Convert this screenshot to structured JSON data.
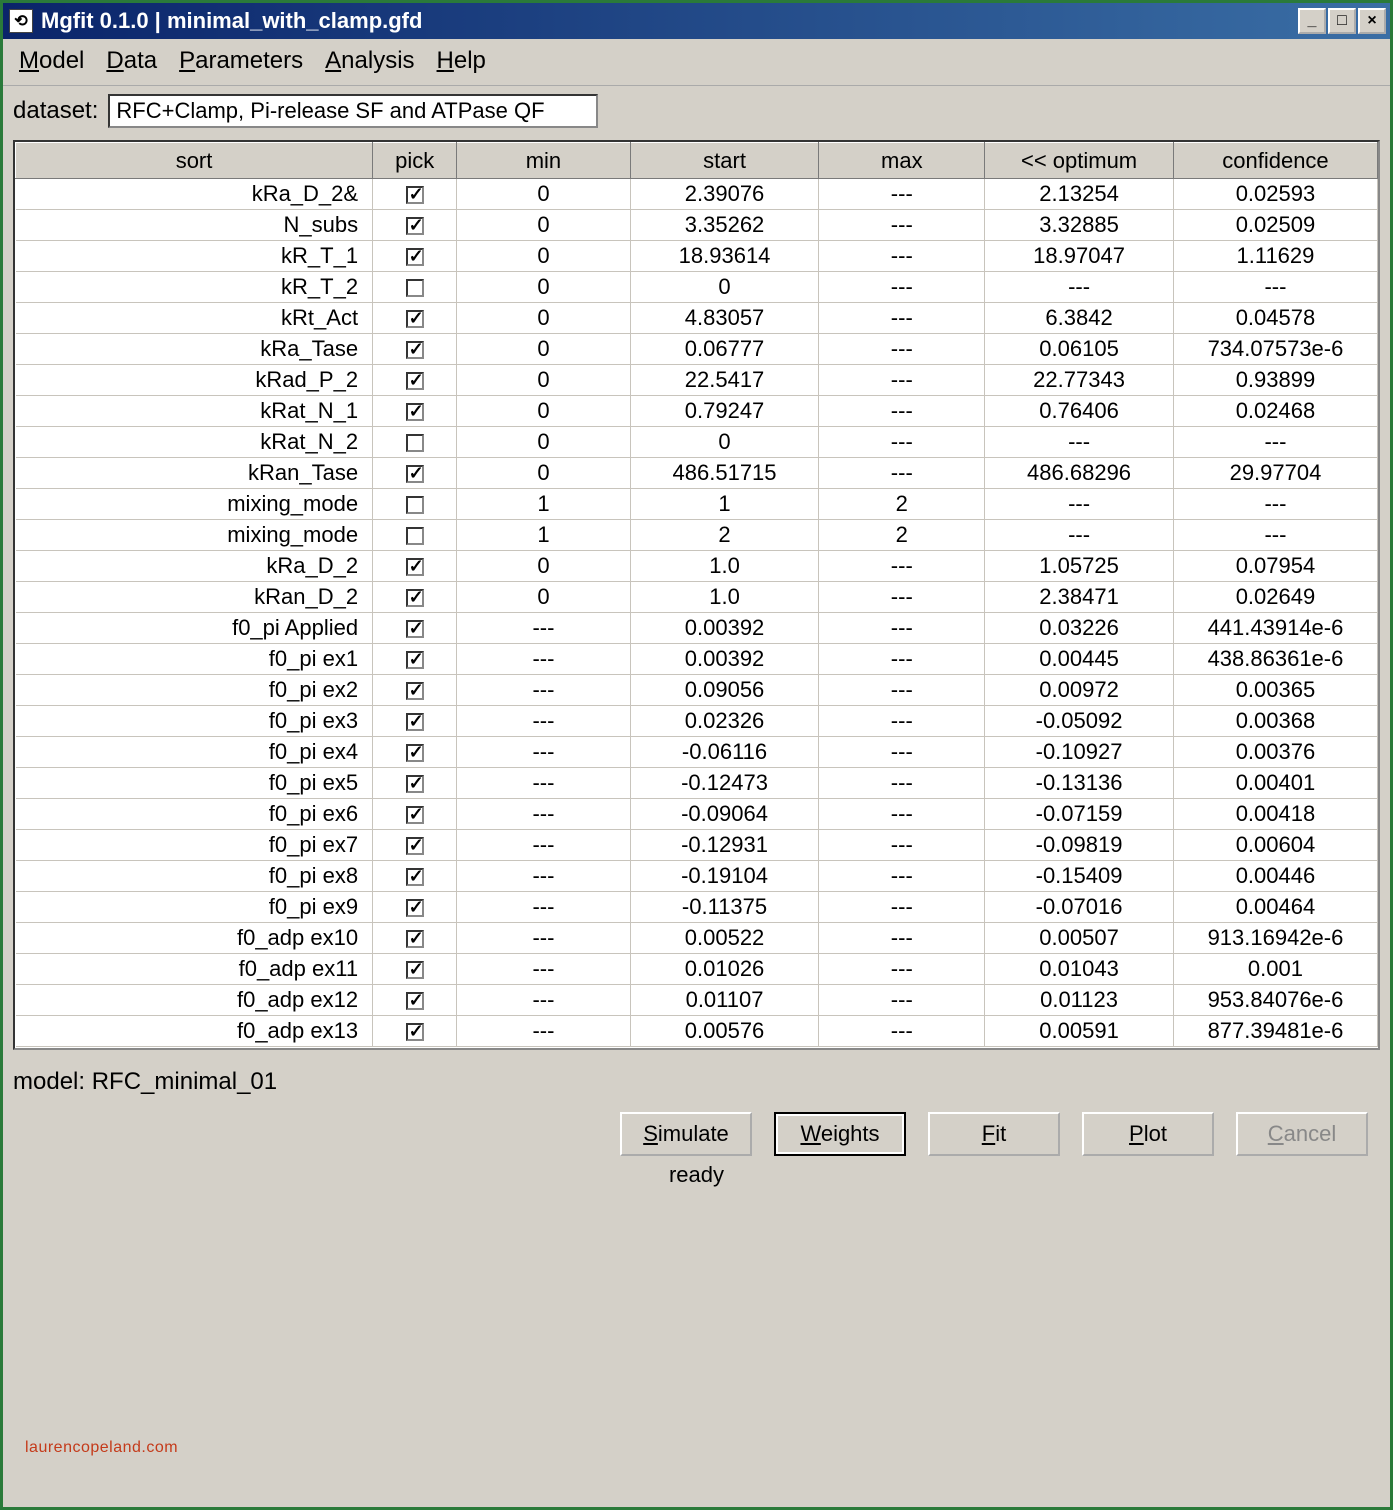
{
  "window": {
    "title": "Mgfit 0.1.0 | minimal_with_clamp.gfd",
    "app_icon_glyph": "⟲"
  },
  "menu": {
    "model": "Model",
    "data": "Data",
    "parameters": "Parameters",
    "analysis": "Analysis",
    "help": "Help"
  },
  "dataset": {
    "label": "dataset:",
    "value": "RFC+Clamp, Pi-release SF and ATPase QF"
  },
  "columns": {
    "sort": "sort",
    "pick": "pick",
    "min": "min",
    "start": "start",
    "max": "max",
    "optimum": "<< optimum",
    "confidence": "confidence"
  },
  "rows": [
    {
      "sort": "kRa_D_2&",
      "pick": true,
      "min": "0",
      "start": "2.39076",
      "max": "---",
      "opt": "2.13254",
      "conf": "0.02593"
    },
    {
      "sort": "N_subs",
      "pick": true,
      "min": "0",
      "start": "3.35262",
      "max": "---",
      "opt": "3.32885",
      "conf": "0.02509"
    },
    {
      "sort": "kR_T_1",
      "pick": true,
      "min": "0",
      "start": "18.93614",
      "max": "---",
      "opt": "18.97047",
      "conf": "1.11629"
    },
    {
      "sort": "kR_T_2",
      "pick": false,
      "min": "0",
      "start": "0",
      "max": "---",
      "opt": "---",
      "conf": "---"
    },
    {
      "sort": "kRt_Act",
      "pick": true,
      "min": "0",
      "start": "4.83057",
      "max": "---",
      "opt": "6.3842",
      "conf": "0.04578"
    },
    {
      "sort": "kRa_Tase",
      "pick": true,
      "min": "0",
      "start": "0.06777",
      "max": "---",
      "opt": "0.06105",
      "conf": "734.07573e-6"
    },
    {
      "sort": "kRad_P_2",
      "pick": true,
      "min": "0",
      "start": "22.5417",
      "max": "---",
      "opt": "22.77343",
      "conf": "0.93899"
    },
    {
      "sort": "kRat_N_1",
      "pick": true,
      "min": "0",
      "start": "0.79247",
      "max": "---",
      "opt": "0.76406",
      "conf": "0.02468"
    },
    {
      "sort": "kRat_N_2",
      "pick": false,
      "min": "0",
      "start": "0",
      "max": "---",
      "opt": "---",
      "conf": "---"
    },
    {
      "sort": "kRan_Tase",
      "pick": true,
      "min": "0",
      "start": "486.51715",
      "max": "---",
      "opt": "486.68296",
      "conf": "29.97704"
    },
    {
      "sort": "mixing_mode",
      "pick": false,
      "min": "1",
      "start": "1",
      "max": "2",
      "opt": "---",
      "conf": "---"
    },
    {
      "sort": "mixing_mode",
      "pick": false,
      "min": "1",
      "start": "2",
      "max": "2",
      "opt": "---",
      "conf": "---"
    },
    {
      "sort": "kRa_D_2",
      "pick": true,
      "min": "0",
      "start": "1.0",
      "max": "---",
      "opt": "1.05725",
      "conf": "0.07954"
    },
    {
      "sort": "kRan_D_2",
      "pick": true,
      "min": "0",
      "start": "1.0",
      "max": "---",
      "opt": "2.38471",
      "conf": "0.02649"
    },
    {
      "sort": "f0_pi Applied",
      "pick": true,
      "min": "---",
      "start": "0.00392",
      "max": "---",
      "opt": "0.03226",
      "conf": "441.43914e-6"
    },
    {
      "sort": "f0_pi ex1",
      "pick": true,
      "min": "---",
      "start": "0.00392",
      "max": "---",
      "opt": "0.00445",
      "conf": "438.86361e-6"
    },
    {
      "sort": "f0_pi ex2",
      "pick": true,
      "min": "---",
      "start": "0.09056",
      "max": "---",
      "opt": "0.00972",
      "conf": "0.00365"
    },
    {
      "sort": "f0_pi ex3",
      "pick": true,
      "min": "---",
      "start": "0.02326",
      "max": "---",
      "opt": "-0.05092",
      "conf": "0.00368"
    },
    {
      "sort": "f0_pi ex4",
      "pick": true,
      "min": "---",
      "start": "-0.06116",
      "max": "---",
      "opt": "-0.10927",
      "conf": "0.00376"
    },
    {
      "sort": "f0_pi ex5",
      "pick": true,
      "min": "---",
      "start": "-0.12473",
      "max": "---",
      "opt": "-0.13136",
      "conf": "0.00401"
    },
    {
      "sort": "f0_pi ex6",
      "pick": true,
      "min": "---",
      "start": "-0.09064",
      "max": "---",
      "opt": "-0.07159",
      "conf": "0.00418"
    },
    {
      "sort": "f0_pi ex7",
      "pick": true,
      "min": "---",
      "start": "-0.12931",
      "max": "---",
      "opt": "-0.09819",
      "conf": "0.00604"
    },
    {
      "sort": "f0_pi ex8",
      "pick": true,
      "min": "---",
      "start": "-0.19104",
      "max": "---",
      "opt": "-0.15409",
      "conf": "0.00446"
    },
    {
      "sort": "f0_pi ex9",
      "pick": true,
      "min": "---",
      "start": "-0.11375",
      "max": "---",
      "opt": "-0.07016",
      "conf": "0.00464"
    },
    {
      "sort": "f0_adp ex10",
      "pick": true,
      "min": "---",
      "start": "0.00522",
      "max": "---",
      "opt": "0.00507",
      "conf": "913.16942e-6"
    },
    {
      "sort": "f0_adp ex11",
      "pick": true,
      "min": "---",
      "start": "0.01026",
      "max": "---",
      "opt": "0.01043",
      "conf": "0.001"
    },
    {
      "sort": "f0_adp ex12",
      "pick": true,
      "min": "---",
      "start": "0.01107",
      "max": "---",
      "opt": "0.01123",
      "conf": "953.84076e-6"
    },
    {
      "sort": "f0_adp ex13",
      "pick": true,
      "min": "---",
      "start": "0.00576",
      "max": "---",
      "opt": "0.00591",
      "conf": "877.39481e-6"
    }
  ],
  "model": {
    "label": "model:",
    "value": "RFC_minimal_01"
  },
  "buttons": {
    "simulate": "Simulate",
    "weights": "Weights",
    "fit": "Fit",
    "plot": "Plot",
    "cancel": "Cancel"
  },
  "status": "ready",
  "watermark": "laurencopeland.com"
}
